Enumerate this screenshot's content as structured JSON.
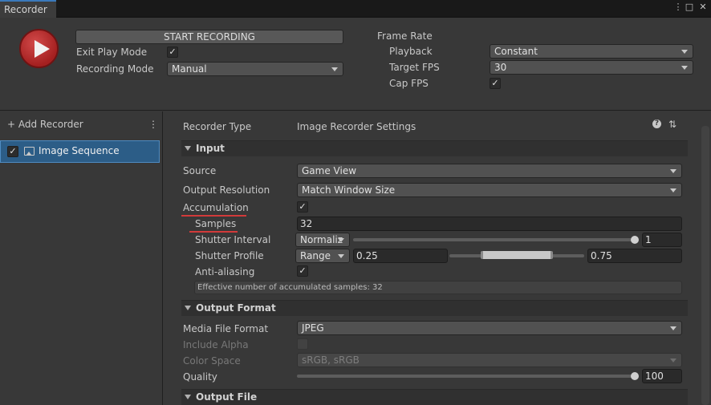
{
  "window": {
    "tab_title": "Recorder"
  },
  "top": {
    "start_recording_label": "START RECORDING",
    "exit_play_mode_label": "Exit Play Mode",
    "recording_mode_label": "Recording Mode",
    "recording_mode_value": "Manual",
    "frame_rate_label": "Frame Rate",
    "playback_label": "Playback",
    "playback_value": "Constant",
    "target_fps_label": "Target FPS",
    "target_fps_value": "30",
    "cap_fps_label": "Cap FPS",
    "check_glyph": "✓"
  },
  "left": {
    "add_recorder_label": "+ Add Recorder",
    "menu_glyph": "⋮",
    "recorder_item_label": "Image Sequence"
  },
  "right": {
    "recorder_type_label": "Recorder Type",
    "recorder_type_value": "Image Recorder Settings",
    "input_header": "Input",
    "source_label": "Source",
    "source_value": "Game View",
    "output_resolution_label": "Output Resolution",
    "output_resolution_value": "Match Window Size",
    "accumulation_label": "Accumulation",
    "samples_label": "Samples",
    "samples_value": "32",
    "shutter_interval_label": "Shutter Interval",
    "shutter_interval_mode": "Normaliz",
    "shutter_interval_value": "1",
    "shutter_profile_label": "Shutter Profile",
    "shutter_profile_mode": "Range",
    "shutter_profile_min": "0.25",
    "shutter_profile_max": "0.75",
    "anti_aliasing_label": "Anti-aliasing",
    "help_text": "Effective number of accumulated samples: 32",
    "output_format_header": "Output Format",
    "media_file_format_label": "Media File Format",
    "media_file_format_value": "JPEG",
    "include_alpha_label": "Include Alpha",
    "color_space_label": "Color Space",
    "color_space_value": "sRGB, sRGB",
    "quality_label": "Quality",
    "quality_value": "100",
    "output_file_header": "Output File",
    "help_glyph": "?",
    "settings_glyph": "⇅"
  },
  "colors": {
    "accent": "#3a79bb",
    "record_red": "#b62a2a",
    "selection": "#2c5d87",
    "annotation_red": "#d23a3a"
  }
}
